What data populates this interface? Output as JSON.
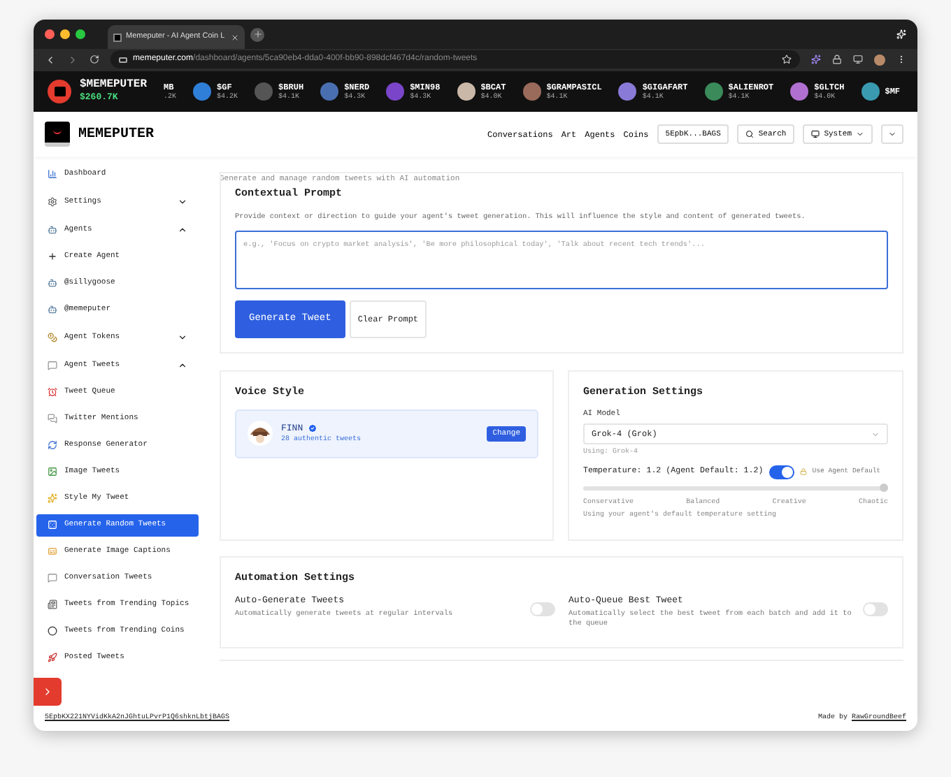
{
  "browser": {
    "tab_title": "Memeputer - AI Agent Coin L",
    "url_domain": "memeputer.com",
    "url_path": "/dashboard/agents/5ca90eb4-dda0-400f-bb90-898dcf467d4c/random-tweets"
  },
  "ticker": {
    "brand": {
      "symbol": "$MEMEPUTER",
      "price": "$260.7K"
    },
    "coins": [
      {
        "symbol": "MB",
        "price": ".2K"
      },
      {
        "symbol": "$GF",
        "price": "$4.2K"
      },
      {
        "symbol": "$BRUH",
        "price": "$4.1K"
      },
      {
        "symbol": "$NERD",
        "price": "$4.3K"
      },
      {
        "symbol": "$MIN98",
        "price": "$4.3K"
      },
      {
        "symbol": "$BCAT",
        "price": "$4.0K"
      },
      {
        "symbol": "$GRAMPASICL",
        "price": "$4.1K"
      },
      {
        "symbol": "$GIGAFART",
        "price": "$4.1K"
      },
      {
        "symbol": "$ALIENROT",
        "price": "$4.1K"
      },
      {
        "symbol": "$GLTCH",
        "price": "$4.0K"
      },
      {
        "symbol": "$MF"
      }
    ]
  },
  "header": {
    "logo": "MEMEPUTER",
    "nav": [
      "Conversations",
      "Art",
      "Agents",
      "Coins"
    ],
    "wallet": "5EpbK...BAGS",
    "search": "Search",
    "theme": "System"
  },
  "sidebar": {
    "items": [
      {
        "label": "Dashboard",
        "kind": "link",
        "selected": false
      },
      {
        "label": "Settings",
        "kind": "group",
        "expanded": false,
        "selected": false
      },
      {
        "label": "Agents",
        "kind": "group",
        "expanded": true,
        "selected": false,
        "children": [
          {
            "label": "Create Agent",
            "selected": false
          },
          {
            "label": "@sillygoose",
            "selected": false
          },
          {
            "label": "@memeputer",
            "selected": false
          }
        ]
      },
      {
        "label": "Agent Tokens",
        "kind": "group",
        "expanded": false,
        "selected": false
      },
      {
        "label": "Agent Tweets",
        "kind": "group",
        "expanded": true,
        "selected": false,
        "children": [
          {
            "label": "Tweet Queue",
            "selected": false
          },
          {
            "label": "Twitter Mentions",
            "selected": false
          },
          {
            "label": "Response Generator",
            "selected": false
          },
          {
            "label": "Image Tweets",
            "selected": false
          },
          {
            "label": "Style My Tweet",
            "selected": false
          },
          {
            "label": "Generate Random Tweets",
            "selected": true
          },
          {
            "label": "Generate Image Captions",
            "selected": false
          },
          {
            "label": "Conversation Tweets",
            "selected": false
          },
          {
            "label": "Tweets from Trending Topics",
            "selected": false
          },
          {
            "label": "Tweets from Trending Coins",
            "selected": false
          },
          {
            "label": "Posted Tweets",
            "selected": false
          }
        ]
      }
    ]
  },
  "page_subtitle": "Generate and manage random tweets with AI automation",
  "contextual_prompt": {
    "title": "Contextual Prompt",
    "description": "Provide context or direction to guide your agent's tweet generation. This will influence the style and content of generated tweets.",
    "placeholder": "e.g., 'Focus on crypto market analysis', 'Be more philosophical today', 'Talk about recent tech trends'...",
    "buttons": [
      "Generate Tweet",
      "Clear Prompt"
    ]
  },
  "voice_style": {
    "title": "Voice Style",
    "name": "FINN",
    "verified": true,
    "subtitle": "28 authentic tweets",
    "button": "Change"
  },
  "generation_settings": {
    "title": "Generation Settings",
    "model_label": "AI Model",
    "model": "Grok-4 (Grok)",
    "using": "Using: Grok-4",
    "temperature": "Temperature: 1.2 (Agent Default: 1.2)",
    "use_default": {
      "label": "Use Agent Default",
      "on": true
    },
    "level": 1,
    "scale": [
      "Conservative",
      "Balanced",
      "Creative",
      "Chaotic"
    ],
    "note": "Using your agent's default temperature setting"
  },
  "automation": {
    "title": "Automation Settings",
    "options": [
      {
        "title": "Auto-Generate Tweets",
        "description": "Automatically generate tweets at regular intervals",
        "on": false
      },
      {
        "title": "Auto-Queue Best Tweet",
        "description": "Automatically select the best tweet from each batch and add it to the queue",
        "on": false
      }
    ]
  },
  "footer": {
    "address": "5EpbKX221NYVidKkA2nJGhtuLPvrP1Q6shknLbtjBAGS",
    "made_by": "Made by",
    "author": "RawGroundBeef"
  }
}
